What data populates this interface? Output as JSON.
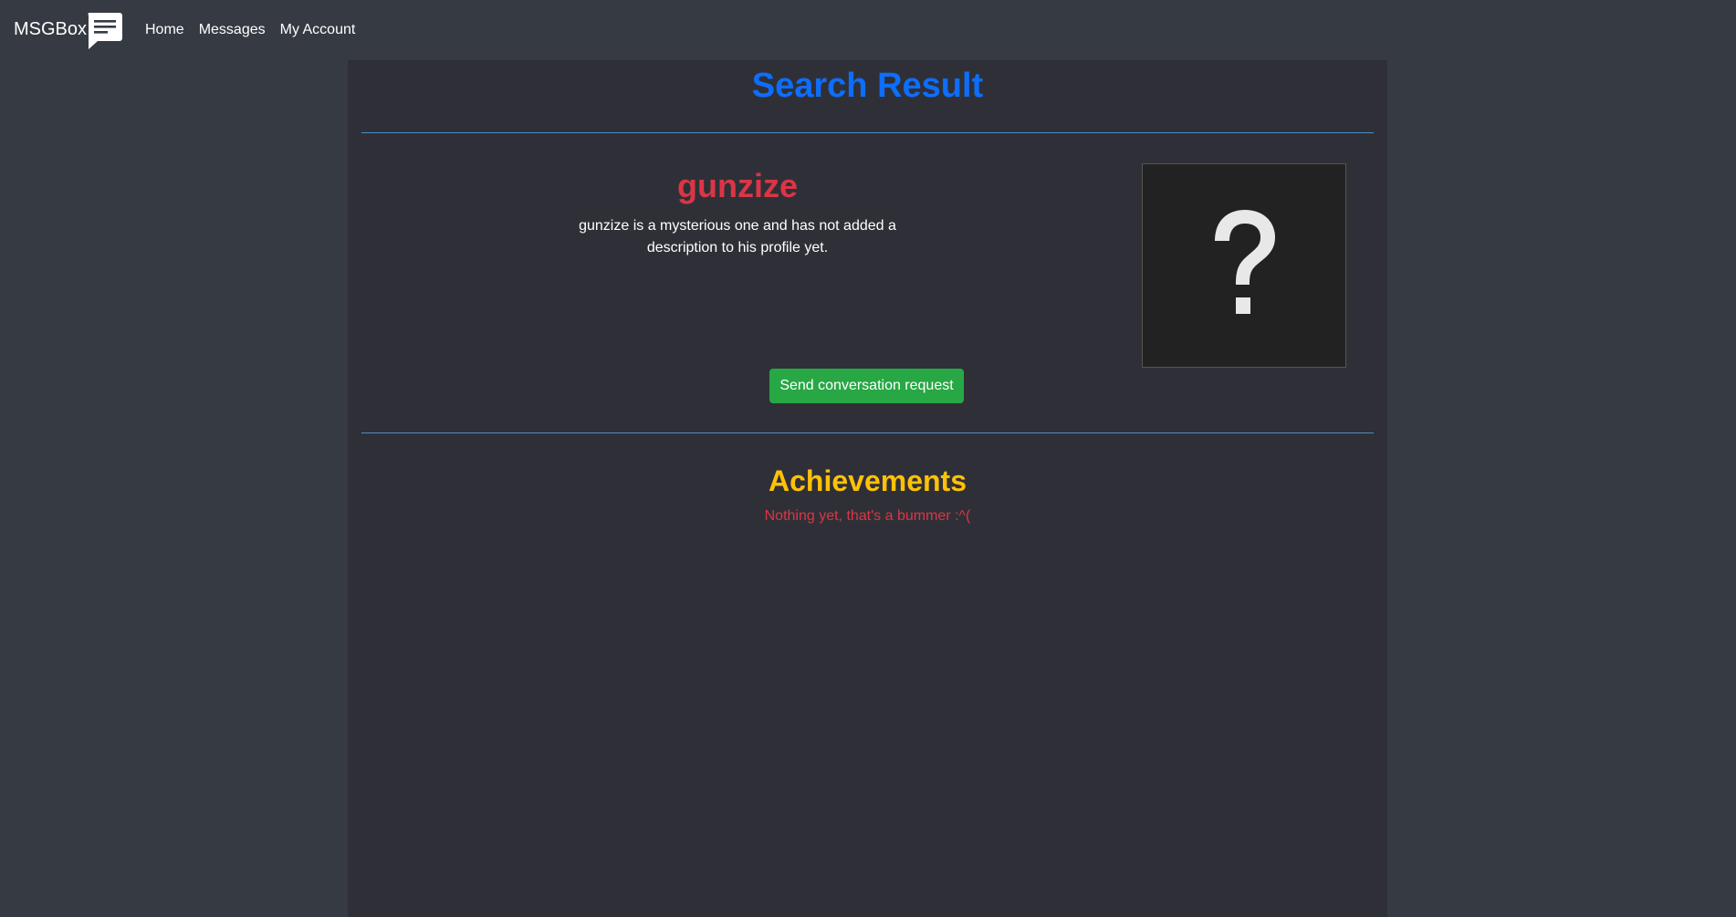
{
  "navbar": {
    "brand_label": "MSGBox",
    "brand_icon": "chat-bubble-icon",
    "links": [
      "Home",
      "Messages",
      "My Account"
    ]
  },
  "main": {
    "title": "Search Result",
    "profile": {
      "username": "gunzize",
      "description": "gunzize is a mysterious one and has not added a description to his profile yet.",
      "avatar_icon": "question-mark-icon",
      "send_button_label": "Send conversation request"
    },
    "achievements": {
      "title": "Achievements",
      "empty_text": "Nothing yet, that's a bummer :^("
    }
  },
  "colors": {
    "page_bg": "#363a42",
    "panel_bg": "#2f3037",
    "title": "#0d6efd",
    "username": "#dc3545",
    "button": "#28a745",
    "achievements_title": "#ffc107",
    "empty_text": "#dc3545",
    "divider": "#4a90c8"
  }
}
